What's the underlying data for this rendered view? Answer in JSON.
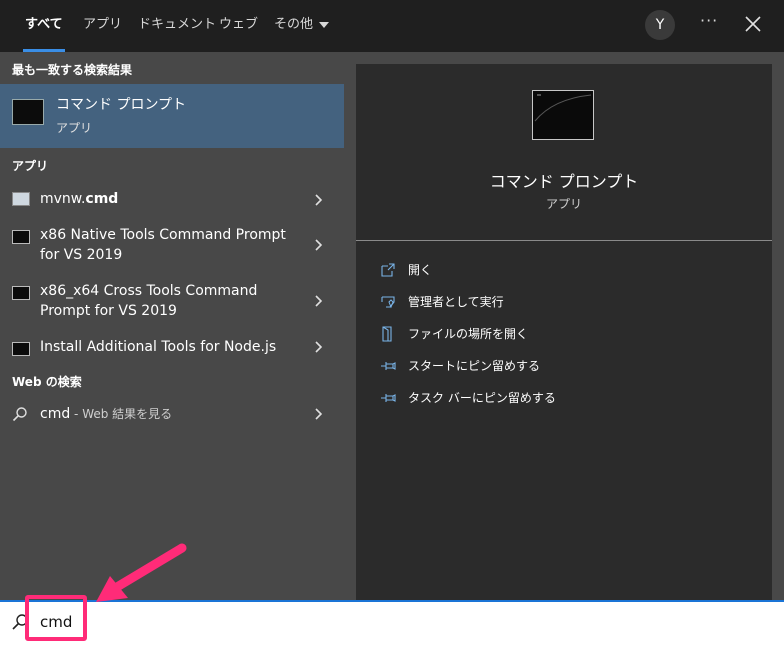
{
  "tabs": [
    {
      "label": "すべて",
      "active": true
    },
    {
      "label": "アプリ",
      "active": false
    },
    {
      "label": "ドキュメント",
      "active": false
    },
    {
      "label": "ウェブ",
      "active": false
    },
    {
      "label": "その他",
      "active": false
    }
  ],
  "user": {
    "initial": "Y"
  },
  "more_label": "···",
  "sections": {
    "best": "最も一致する検索結果",
    "apps": "アプリ",
    "web": "Web の検索"
  },
  "best_match": {
    "title": "コマンド プロンプト",
    "subtitle": "アプリ"
  },
  "apps": [
    {
      "name_prefix": "mvnw.",
      "name_bold": "cmd",
      "line2": ""
    },
    {
      "name_prefix": "x86 Native Tools Command Prompt",
      "name_bold": "",
      "line2": "for VS 2019"
    },
    {
      "name_prefix": "x86_x64 Cross Tools Command",
      "name_bold": "",
      "line2": "Prompt for VS 2019"
    },
    {
      "name_prefix": "Install Additional Tools for Node.js",
      "name_bold": "",
      "line2": ""
    }
  ],
  "web": {
    "query": "cmd",
    "suffix": " - Web 結果を見る"
  },
  "preview": {
    "title": "コマンド プロンプト",
    "subtitle": "アプリ"
  },
  "actions": [
    {
      "label": "開く",
      "icon": "open-icon"
    },
    {
      "label": "管理者として実行",
      "icon": "shield-icon"
    },
    {
      "label": "ファイルの場所を開く",
      "icon": "file-location-icon"
    },
    {
      "label": "スタートにピン留めする",
      "icon": "pin-icon"
    },
    {
      "label": "タスク バーにピン留めする",
      "icon": "pin-icon"
    }
  ],
  "search": {
    "value": "cmd"
  },
  "colors": {
    "accent": "#3a8ee6",
    "selected": "#44627f",
    "highlight": "#ff2b78"
  }
}
